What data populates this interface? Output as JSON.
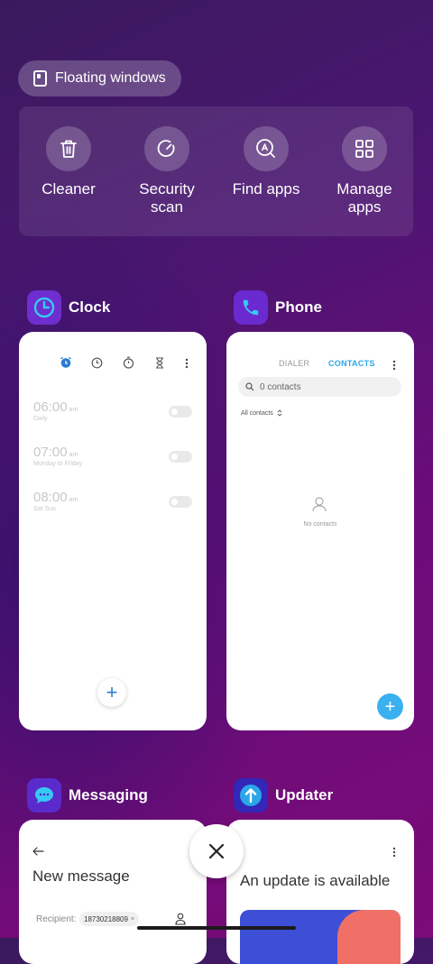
{
  "floating_windows": {
    "label": "Floating windows"
  },
  "tools": [
    {
      "label": "Cleaner",
      "icon": "trash-icon"
    },
    {
      "label": "Security\nscan",
      "icon": "security-scan-icon"
    },
    {
      "label": "Find apps",
      "icon": "find-apps-icon"
    },
    {
      "label": "Manage\napps",
      "icon": "manage-apps-icon"
    }
  ],
  "clock": {
    "app_name": "Clock",
    "alarms": [
      {
        "time": "06:00",
        "ampm": "am",
        "repeat": "Daily"
      },
      {
        "time": "07:00",
        "ampm": "am",
        "repeat": "Monday to Friday"
      },
      {
        "time": "08:00",
        "ampm": "am",
        "repeat": "Sat Sun"
      }
    ]
  },
  "phone": {
    "app_name": "Phone",
    "tabs": {
      "dialer": "DIALER",
      "contacts": "CONTACTS"
    },
    "search_text": "0 contacts",
    "filter": "All contacts",
    "empty_text": "No contacts"
  },
  "messaging": {
    "app_name": "Messaging",
    "title": "New message",
    "recipient_label": "Recipient:",
    "recipient_chip": "18730218809"
  },
  "updater": {
    "app_name": "Updater",
    "title": "An update is available"
  },
  "colors": {
    "accent_blue": "#2b7cd3",
    "contacts_tab": "#2aa7e8",
    "fab_blue": "#3ab0f0"
  }
}
